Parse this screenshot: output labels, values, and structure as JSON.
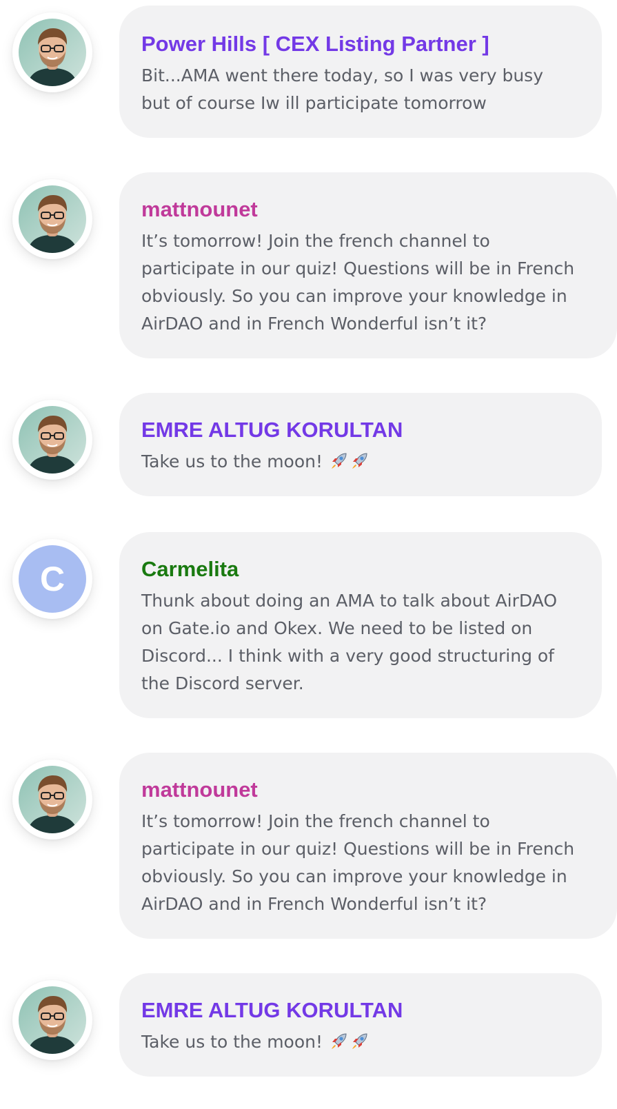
{
  "colors": {
    "purple": "#7339e6",
    "magenta": "#c03a9a",
    "green": "#1a7a10",
    "bubble_bg": "#f2f2f3",
    "text": "#5b5e66",
    "letter_avatar_bg": "#a8bdf2"
  },
  "messages": [
    {
      "author": "Power Hills [ CEX Listing Partner ]",
      "author_color": "#7339e6",
      "avatar": "photo",
      "lines": [
        "Bit...AMA went there today, so I was very busy",
        "but of course Iw ill participate tomorrow"
      ]
    },
    {
      "author": "mattnounet",
      "author_color": "#c03a9a",
      "avatar": "photo",
      "lines": [
        "It’s tomorrow! Join the french channel to",
        "participate in our quiz! Questions will be in French",
        "obviously. So you can improve your knowledge in",
        "AirDAO and in French Wonderful isn’t it?"
      ]
    },
    {
      "author": "EMRE ALTUG KORULTAN",
      "author_color": "#7339e6",
      "avatar": "photo",
      "text": "Take us to the moon!",
      "emoji": [
        "rocket-icon",
        "rocket-icon"
      ]
    },
    {
      "author": "Carmelita",
      "author_color": "#1a7a10",
      "avatar": "letter",
      "avatar_letter": "C",
      "lines": [
        "Thunk about doing an AMA to talk about AirDAO",
        "on Gate.io and Okex. We need to be listed on",
        "Discord... I think with a very good structuring of",
        "the Discord server."
      ]
    },
    {
      "author": "mattnounet",
      "author_color": "#c03a9a",
      "avatar": "photo",
      "lines": [
        "It’s tomorrow! Join the french channel to",
        "participate in our quiz! Questions will be in French",
        "obviously. So you can improve your knowledge in",
        "AirDAO and in French Wonderful isn’t it?"
      ]
    },
    {
      "author": "EMRE ALTUG KORULTAN",
      "author_color": "#7339e6",
      "avatar": "photo",
      "text": "Take us to the moon!",
      "emoji": [
        "rocket-icon",
        "rocket-icon"
      ]
    }
  ]
}
